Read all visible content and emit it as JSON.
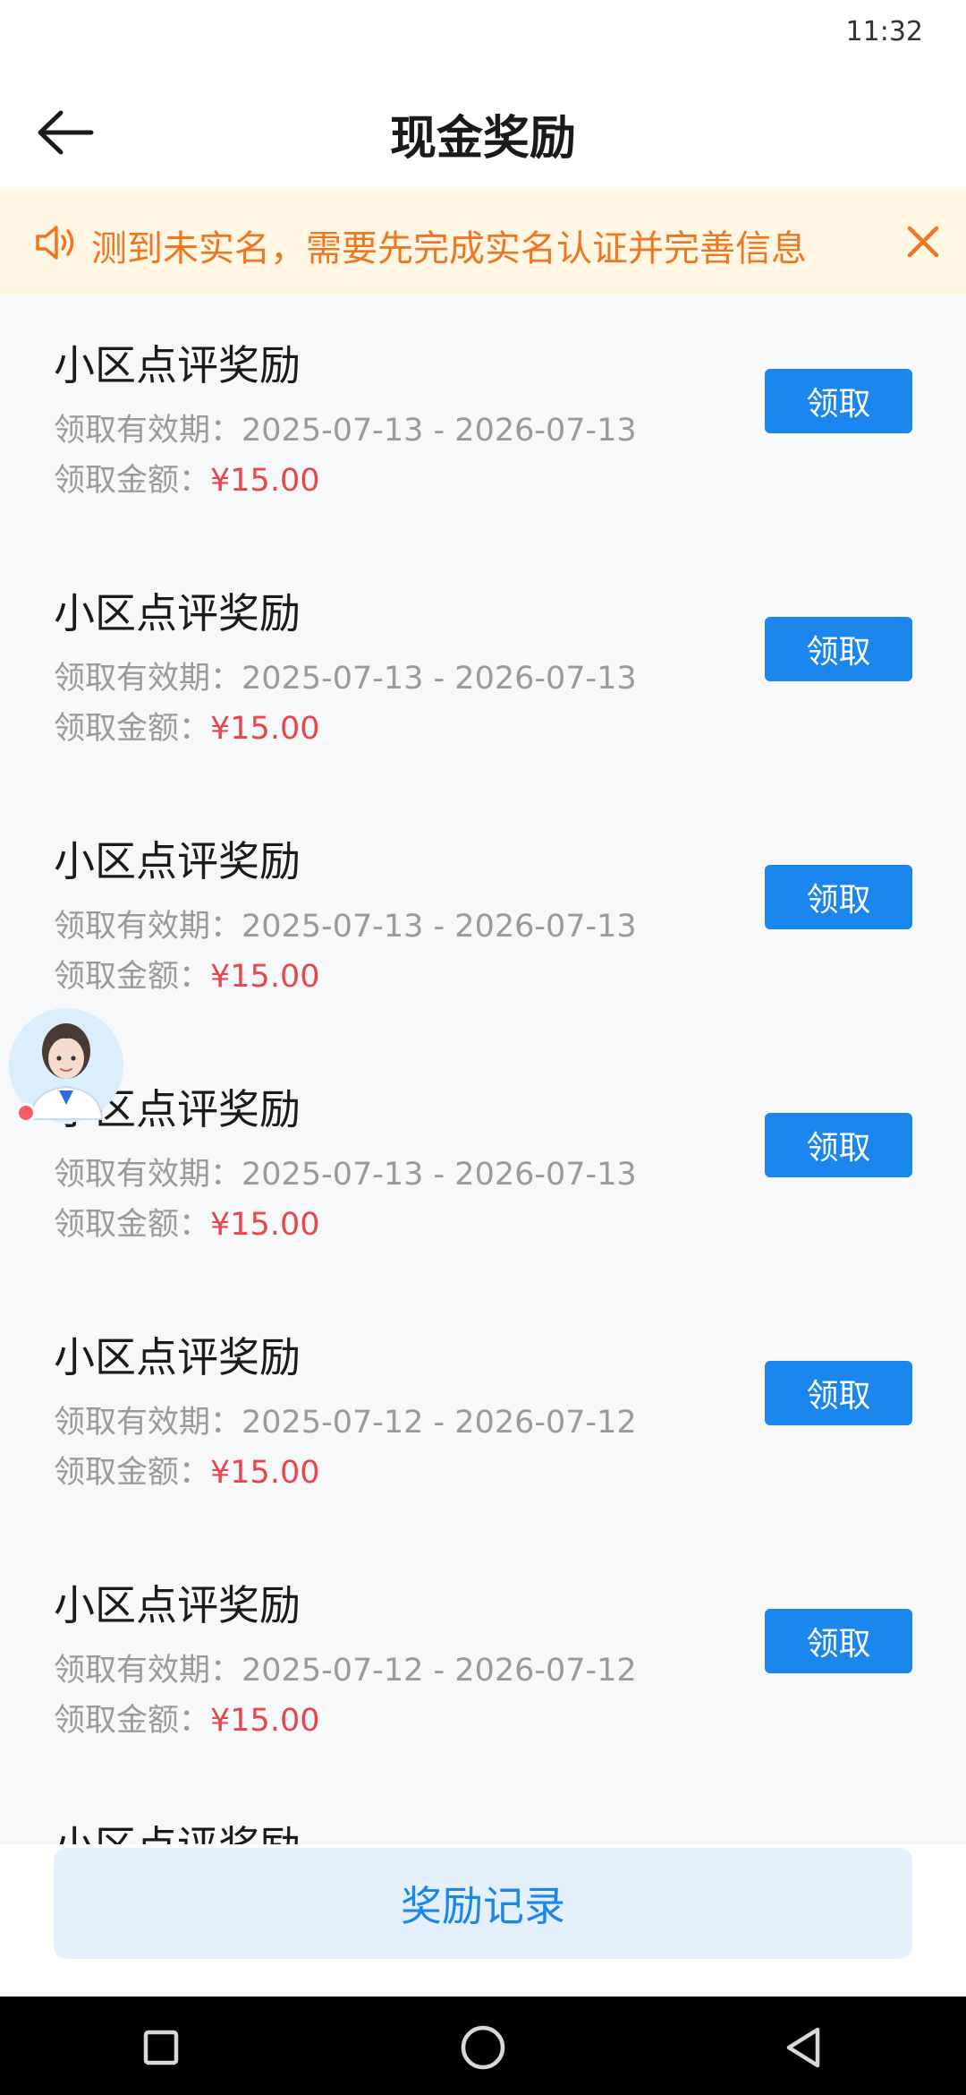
{
  "status_bar": {
    "time": "11:32"
  },
  "header": {
    "title": "现金奖励"
  },
  "notice": {
    "text": "测到未实名，需要先完成实名认证并完善信息"
  },
  "rewards": [
    {
      "title": "小区点评奖励",
      "period_label": "领取有效期：",
      "period": "2025-07-13 - 2026-07-13",
      "amount_label": "领取金额：",
      "amount": "¥15.00",
      "button": "领取"
    },
    {
      "title": "小区点评奖励",
      "period_label": "领取有效期：",
      "period": "2025-07-13 - 2026-07-13",
      "amount_label": "领取金额：",
      "amount": "¥15.00",
      "button": "领取"
    },
    {
      "title": "小区点评奖励",
      "period_label": "领取有效期：",
      "period": "2025-07-13 - 2026-07-13",
      "amount_label": "领取金额：",
      "amount": "¥15.00",
      "button": "领取"
    },
    {
      "title": "小区点评奖励",
      "period_label": "领取有效期：",
      "period": "2025-07-13 - 2026-07-13",
      "amount_label": "领取金额：",
      "amount": "¥15.00",
      "button": "领取"
    },
    {
      "title": "小区点评奖励",
      "period_label": "领取有效期：",
      "period": "2025-07-12 - 2026-07-12",
      "amount_label": "领取金额：",
      "amount": "¥15.00",
      "button": "领取"
    },
    {
      "title": "小区点评奖励",
      "period_label": "领取有效期：",
      "period": "2025-07-12 - 2026-07-12",
      "amount_label": "领取金额：",
      "amount": "¥15.00",
      "button": "领取"
    },
    {
      "title": "小区点评奖励"
    }
  ],
  "footer": {
    "records_button": "奖励记录"
  },
  "icons": {
    "back": "arrow-left-icon",
    "notice": "speaker-icon",
    "close": "close-icon",
    "assistant": "ai-avatar-icon",
    "nav_recent": "square-icon",
    "nav_home": "circle-icon",
    "nav_back": "triangle-back-icon"
  },
  "colors": {
    "accent": "#1a86ee",
    "amount": "#e8464c",
    "notice_text": "#ee7722",
    "notice_bg": "#fff6e3",
    "records_bg": "#e4f1fd"
  }
}
